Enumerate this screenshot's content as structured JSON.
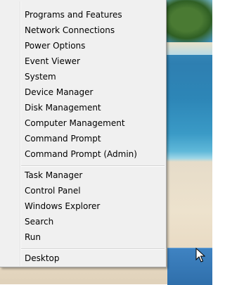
{
  "menu": {
    "group1": [
      {
        "label": "Programs and Features"
      },
      {
        "label": "Network Connections"
      },
      {
        "label": "Power Options"
      },
      {
        "label": "Event Viewer"
      },
      {
        "label": "System"
      },
      {
        "label": "Device Manager"
      },
      {
        "label": "Disk Management"
      },
      {
        "label": "Computer Management"
      },
      {
        "label": "Command Prompt"
      },
      {
        "label": "Command Prompt (Admin)"
      }
    ],
    "group2": [
      {
        "label": "Task Manager"
      },
      {
        "label": "Control Panel"
      },
      {
        "label": "Windows Explorer"
      },
      {
        "label": "Search"
      },
      {
        "label": "Run"
      }
    ],
    "group3": [
      {
        "label": "Desktop"
      }
    ]
  },
  "icons": {
    "cursor": "mouse-pointer-icon"
  },
  "colors": {
    "menu_background": "#f0f0f0",
    "menu_border": "#a7a7a7",
    "taskbar": "#2f6fab"
  }
}
